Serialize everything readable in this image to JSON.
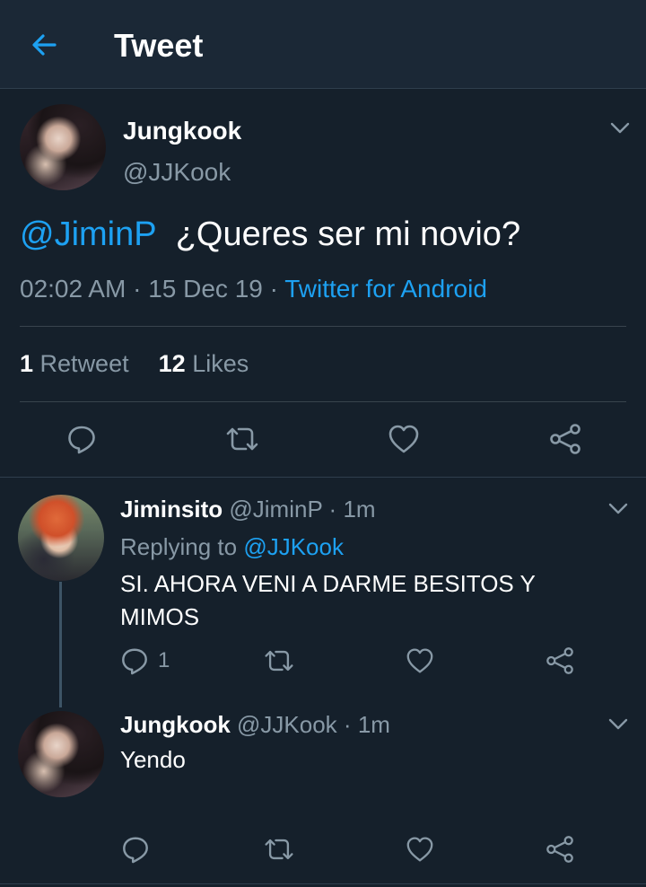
{
  "topbar": {
    "title": "Tweet"
  },
  "tweet": {
    "name": "Jungkook",
    "handle": "@JJKook",
    "mention": "@JiminP",
    "text": "¿Queres ser mi novio?",
    "time": "02:02 AM",
    "date": "15 Dec 19",
    "source": "Twitter for Android",
    "retweet_count": "1",
    "retweet_label": "Retweet",
    "like_count": "12",
    "like_label": "Likes"
  },
  "replies": [
    {
      "name": "Jiminsito",
      "handle": "@JiminP",
      "age": "1m",
      "replying_prefix": "Replying to",
      "replying_to": "@JJKook",
      "text": "SI. AHORA VENI A DARME BESITOS Y MIMOS",
      "reply_count": "1"
    },
    {
      "name": "Jungkook",
      "handle": "@JJKook",
      "age": "1m",
      "text": "Yendo"
    }
  ],
  "colors": {
    "background": "#15202b",
    "accent": "#1da1f2",
    "secondary_text": "#8899a6"
  }
}
